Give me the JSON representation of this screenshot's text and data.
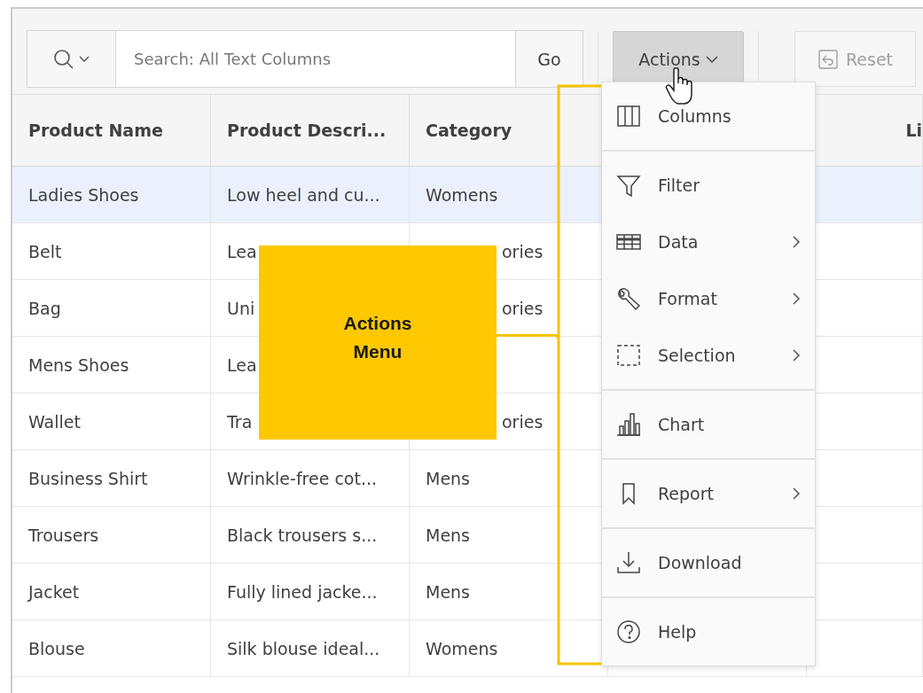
{
  "toolbar": {
    "search": {
      "placeholder": "Search: All Text Columns"
    },
    "go_button": "Go",
    "actions_button": {
      "label": "Actions",
      "pressed": true
    },
    "reset_button": {
      "label": "Reset",
      "disabled": true
    }
  },
  "table": {
    "columns": [
      "Product Name",
      "Product Descri...",
      "Category",
      "",
      "Li"
    ],
    "rows": [
      {
        "selected": true,
        "covered": false,
        "cells": [
          "Ladies Shoes",
          "Low heel and cu...",
          "Womens"
        ]
      },
      {
        "selected": false,
        "covered": true,
        "cells": [
          "Belt",
          "Lea",
          "ories"
        ]
      },
      {
        "selected": false,
        "covered": true,
        "cells": [
          "Bag",
          "Uni",
          "ories"
        ]
      },
      {
        "selected": false,
        "cells": [
          "Mens Shoes",
          "Lea"
        ]
      },
      {
        "selected": false,
        "covered": true,
        "cells": [
          "Wallet",
          "Tra",
          "ories"
        ]
      },
      {
        "selected": false,
        "covered": false,
        "cells": [
          "Business Shirt",
          "Wrinkle-free cot...",
          "Mens"
        ]
      },
      {
        "selected": false,
        "covered": false,
        "cells": [
          "Trousers",
          "Black trousers s...",
          "Mens"
        ]
      },
      {
        "selected": false,
        "covered": false,
        "cells": [
          "Jacket",
          "Fully lined jacke...",
          "Mens"
        ]
      },
      {
        "selected": false,
        "covered": false,
        "cells": [
          "Blouse",
          "Silk blouse ideal...",
          "Womens"
        ]
      }
    ]
  },
  "actions_menu": {
    "groups": [
      [
        {
          "kind": "columns",
          "label": "Columns",
          "submenu": false
        }
      ],
      [
        {
          "kind": "filter",
          "label": "Filter",
          "submenu": false
        },
        {
          "kind": "data",
          "label": "Data",
          "submenu": true
        },
        {
          "kind": "format",
          "label": "Format",
          "submenu": true
        },
        {
          "kind": "selection",
          "label": "Selection",
          "submenu": true
        }
      ],
      [
        {
          "kind": "chart",
          "label": "Chart",
          "submenu": false
        }
      ],
      [
        {
          "kind": "report",
          "label": "Report",
          "submenu": true
        }
      ],
      [
        {
          "kind": "download",
          "label": "Download",
          "submenu": false
        }
      ],
      [
        {
          "kind": "help",
          "label": "Help",
          "submenu": false
        }
      ]
    ]
  },
  "callout": {
    "text": "Actions\nMenu"
  }
}
